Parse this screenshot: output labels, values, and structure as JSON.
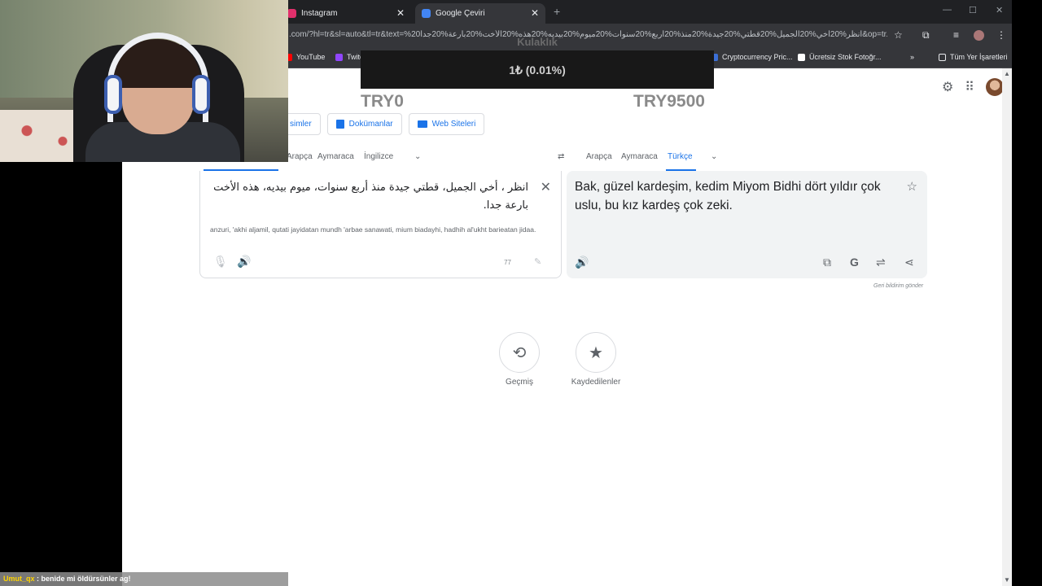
{
  "browser": {
    "tabs": [
      {
        "title": "Instagram",
        "color": "#e1306c"
      },
      {
        "title": "Google Çeviri",
        "color": "#4285f4"
      }
    ],
    "url": ".com/?hl=tr&sl=auto&tl=tr&text=%20انظر%20أخي%20الجميل%20قطتي%20جيدة%20منذ%20أربع%20سنوات%20ميوم%20بيديه%20هذه%20الأخت%20بارعة%20جدا&op=tr...",
    "bookmarks": [
      "YouTube",
      "Twitch",
      "Cryptocurrency Pric...",
      "Ücretsiz Stok Fotoğr...",
      "Tüm Yer İşaretleri"
    ]
  },
  "translate": {
    "modes": [
      "simler",
      "Dokümanlar",
      "Web Siteleri"
    ],
    "source_langs": [
      "Arapça",
      "Aymaraca",
      "İngilizce"
    ],
    "target_langs": [
      "Arapça",
      "Aymaraca",
      "Türkçe"
    ],
    "source_text": "انظر ، أخي الجميل، قطتي جيدة منذ أربع سنوات، ميوم بيديه، هذه الأخت بارعة جدا.",
    "transliteration": "anzuri, 'akhi aljamil, qutati jayidatan mundh 'arbae sanawati, mium biadayhi, hadhih al'ukht barieatan jidaa.",
    "char_count": "77",
    "target_text": "Bak, güzel kardeşim, kedim Miyom Bidhi dört yıldır çok uslu, bu kız kardeş çok zeki.",
    "feedback": "Geri bildirim gönder",
    "history_label": "Geçmiş",
    "saved_label": "Kaydedilenler"
  },
  "overlay": {
    "donation_title": "Kulaklık",
    "donation_value": "1₺ (0.01%)",
    "goal_start": "TRY0",
    "goal_end": "TRY9500",
    "chat_user": "Umut_qx",
    "chat_message": " : benide mi öldürsünler ag!"
  }
}
